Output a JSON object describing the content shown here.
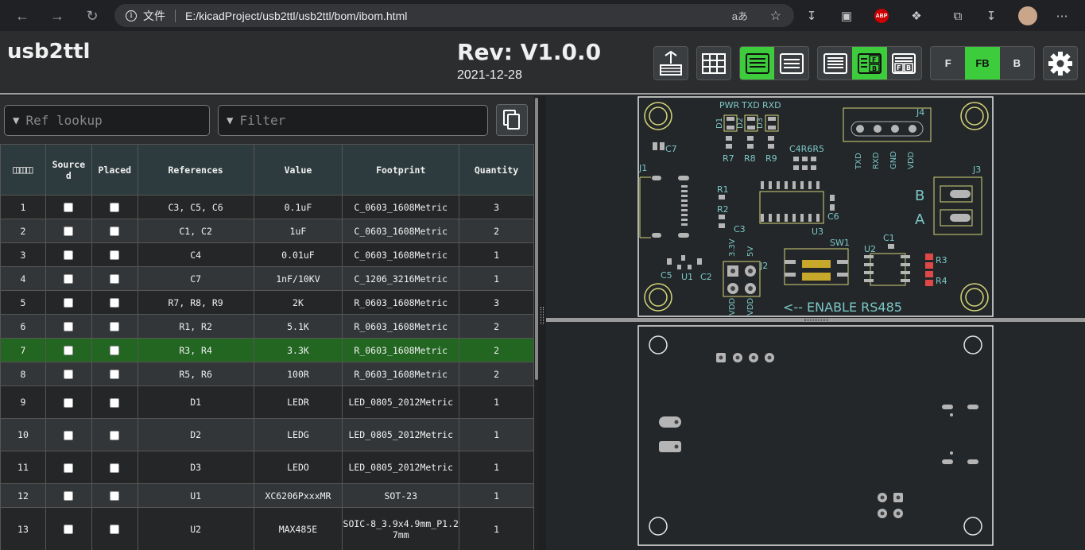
{
  "browser": {
    "address_label": "文件",
    "url": "E:/kicadProject/usb2ttl/usb2ttl/bom/ibom.html",
    "read_aloud": "aあ"
  },
  "header": {
    "title": "usb2ttl",
    "revision": "Rev: V1.0.0",
    "date": "2021-12-28",
    "layer_buttons": [
      "F",
      "FB",
      "B"
    ],
    "active_layer": "FB"
  },
  "search": {
    "ref_placeholder": "Ref lookup",
    "filter_placeholder": "Filter"
  },
  "bom": {
    "columns": [
      "Source d",
      "Placed",
      "References",
      "Value",
      "Footprint",
      "Quantity"
    ],
    "column_labels": {
      "sourced": "Source\nd",
      "placed": "Placed",
      "references": "References",
      "value": "Value",
      "footprint": "Footprint",
      "quantity": "Quantity"
    },
    "highlighted_row": 7,
    "rows": [
      {
        "num": "1",
        "refs": "C3, C5, C6",
        "value": "0.1uF",
        "footprint": "C_0603_1608Metric",
        "qty": "3"
      },
      {
        "num": "2",
        "refs": "C1, C2",
        "value": "1uF",
        "footprint": "C_0603_1608Metric",
        "qty": "2"
      },
      {
        "num": "3",
        "refs": "C4",
        "value": "0.01uF",
        "footprint": "C_0603_1608Metric",
        "qty": "1"
      },
      {
        "num": "4",
        "refs": "C7",
        "value": "1nF/10KV",
        "footprint": "C_1206_3216Metric",
        "qty": "1"
      },
      {
        "num": "5",
        "refs": "R7, R8, R9",
        "value": "2K",
        "footprint": "R_0603_1608Metric",
        "qty": "3"
      },
      {
        "num": "6",
        "refs": "R1, R2",
        "value": "5.1K",
        "footprint": "R_0603_1608Metric",
        "qty": "2"
      },
      {
        "num": "7",
        "refs": "R3, R4",
        "value": "3.3K",
        "footprint": "R_0603_1608Metric",
        "qty": "2"
      },
      {
        "num": "8",
        "refs": "R5, R6",
        "value": "100R",
        "footprint": "R_0603_1608Metric",
        "qty": "2"
      },
      {
        "num": "9",
        "refs": "D1",
        "value": "LEDR",
        "footprint": "LED_0805_2012Metric",
        "qty": "1"
      },
      {
        "num": "10",
        "refs": "D2",
        "value": "LEDG",
        "footprint": "LED_0805_2012Metric",
        "qty": "1"
      },
      {
        "num": "11",
        "refs": "D3",
        "value": "LEDO",
        "footprint": "LED_0805_2012Metric",
        "qty": "1"
      },
      {
        "num": "12",
        "refs": "U1",
        "value": "XC6206PxxxMR",
        "footprint": "SOT-23",
        "qty": "1"
      },
      {
        "num": "13",
        "refs": "U2",
        "value": "MAX485E",
        "footprint": "SOIC-8_3.9x4.9mm_P1.27mm",
        "qty": "1"
      }
    ]
  },
  "pcb_front": {
    "labels": {
      "pwr": "PWR",
      "txd": "TXD",
      "rxd": "RXD",
      "d1": "D1",
      "d2": "D2",
      "d3": "D3",
      "c7": "C7",
      "c4r6r5": "C4R6R5",
      "j4": "J4",
      "j1": "J1",
      "j3": "J3",
      "r7": "R7",
      "r8": "R8",
      "r9": "R9",
      "r1": "R1",
      "r2": "R2",
      "c3": "C3",
      "c6": "C6",
      "u3": "U3",
      "b": "B",
      "a": "A",
      "sw1": "SW1",
      "c1": "C1",
      "u2": "U2",
      "r3": "R3",
      "r4": "R4",
      "c5": "C5",
      "u1": "U1",
      "c2": "C2",
      "j2": "J2",
      "v33": "3.3V",
      "v5": "5V",
      "vdd1": "VDD",
      "vdd2": "VDD",
      "txd_v": "TXD",
      "rxd_v": "RXD",
      "gnd_v": "GND",
      "vdd_v": "VDD",
      "enable": "<-- ENABLE RS485"
    }
  }
}
